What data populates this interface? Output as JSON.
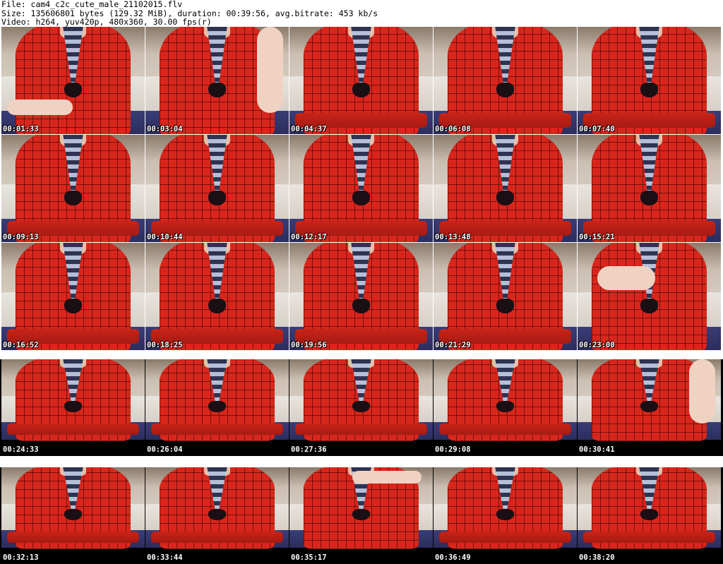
{
  "header": {
    "file_line": "File: cam4_c2c_cute_male_21102015.flv",
    "size_line": "Size: 135606801 bytes (129.32 MiB), duration: 00:39:56, avg.bitrate: 453 kb/s",
    "video_line": "Video: h264, yuv420p, 480x360, 30.00 fps(r)"
  },
  "rows": [
    {
      "timestamps": [
        "00:01:33",
        "00:03:04",
        "00:04:37",
        "00:06:08",
        "00:07:40"
      ]
    },
    {
      "timestamps": [
        "00:09:13",
        "00:10:44",
        "00:12:17",
        "00:13:48",
        "00:15:21"
      ]
    },
    {
      "timestamps": [
        "00:16:52",
        "00:18:25",
        "00:19:56",
        "00:21:29",
        "00:23:00"
      ]
    },
    {
      "timestamps": [
        "00:24:33",
        "00:26:04",
        "00:27:36",
        "00:29:08",
        "00:30:41"
      ]
    },
    {
      "timestamps": [
        "00:32:13",
        "00:33:44",
        "00:35:17",
        "00:36:49",
        "00:38:20"
      ]
    }
  ]
}
